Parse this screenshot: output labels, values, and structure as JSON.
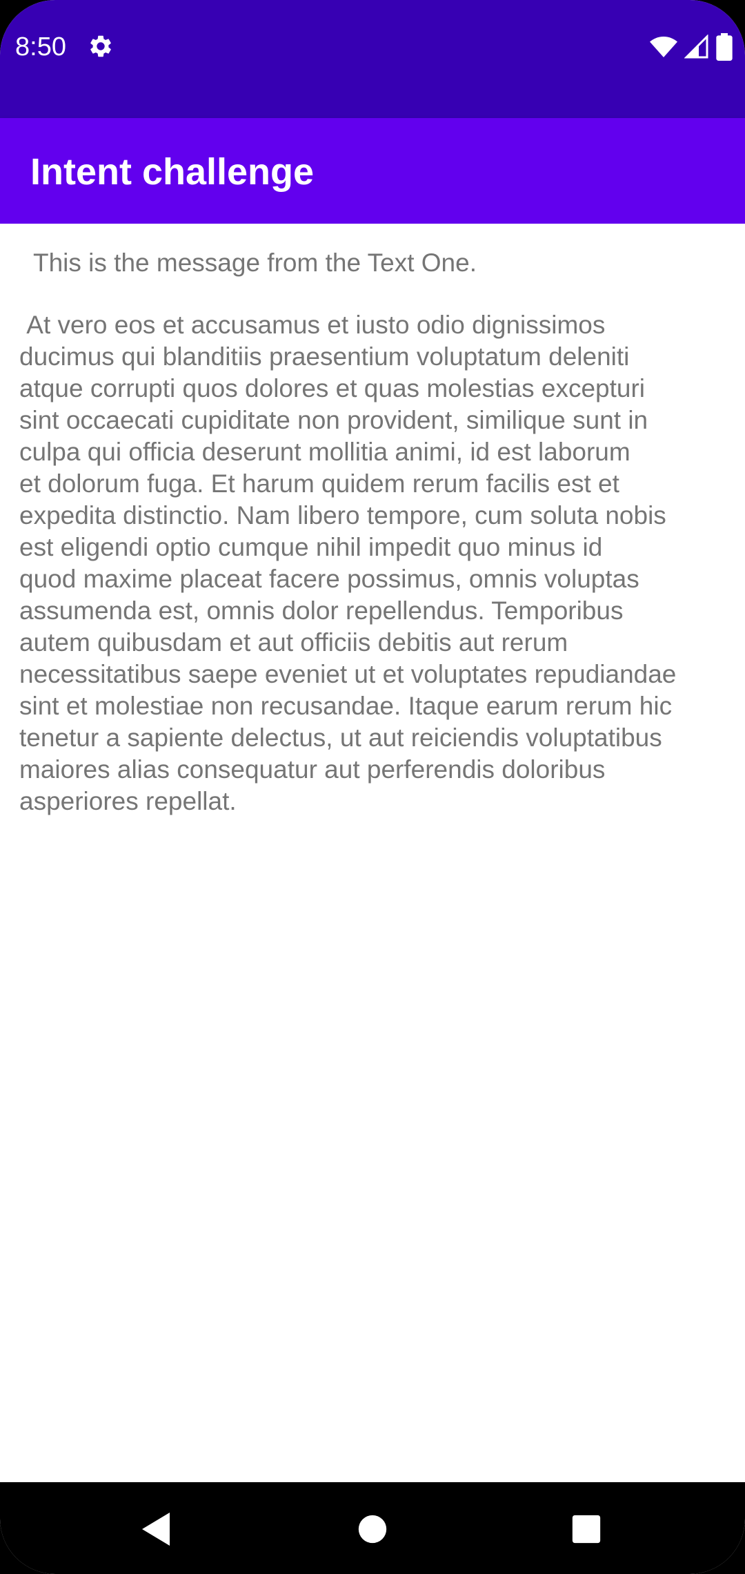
{
  "status_bar": {
    "time": "8:50",
    "icons": [
      "gear-icon",
      "wifi-icon",
      "cell-signal-icon",
      "battery-icon"
    ]
  },
  "app_bar": {
    "title": "Intent challenge"
  },
  "content": {
    "message_one": "This is the message from the Text One.",
    "body_text": " At vero eos et accusamus et iusto odio dignissimos\nducimus qui blanditiis praesentium voluptatum deleniti\natque corrupti quos dolores et quas molestias excepturi\nsint occaecati cupiditate non provident, similique sunt in\nculpa qui officia deserunt mollitia animi, id est laborum\net dolorum fuga. Et harum quidem rerum facilis est et\nexpedita distinctio. Nam libero tempore, cum soluta nobis\nest eligendi optio cumque nihil impedit quo minus id\nquod maxime placeat facere possimus, omnis voluptas\nassumenda est, omnis dolor repellendus. Temporibus\nautem quibusdam et aut officiis debitis aut rerum\nnecessitatibus saepe eveniet ut et voluptates repudiandae\nsint et molestiae non recusandae. Itaque earum rerum hic\ntenetur a sapiente delectus, ut aut reiciendis voluptatibus\nmaiores alias consequatur aut perferendis doloribus\nasperiores repellat."
  },
  "nav_bar": {
    "buttons": [
      "back-icon",
      "home-icon",
      "recents-icon"
    ]
  },
  "colors": {
    "status_bar": "#3700b3",
    "app_bar": "#6200ee",
    "text": "#757575",
    "nav_bar": "#000000"
  }
}
